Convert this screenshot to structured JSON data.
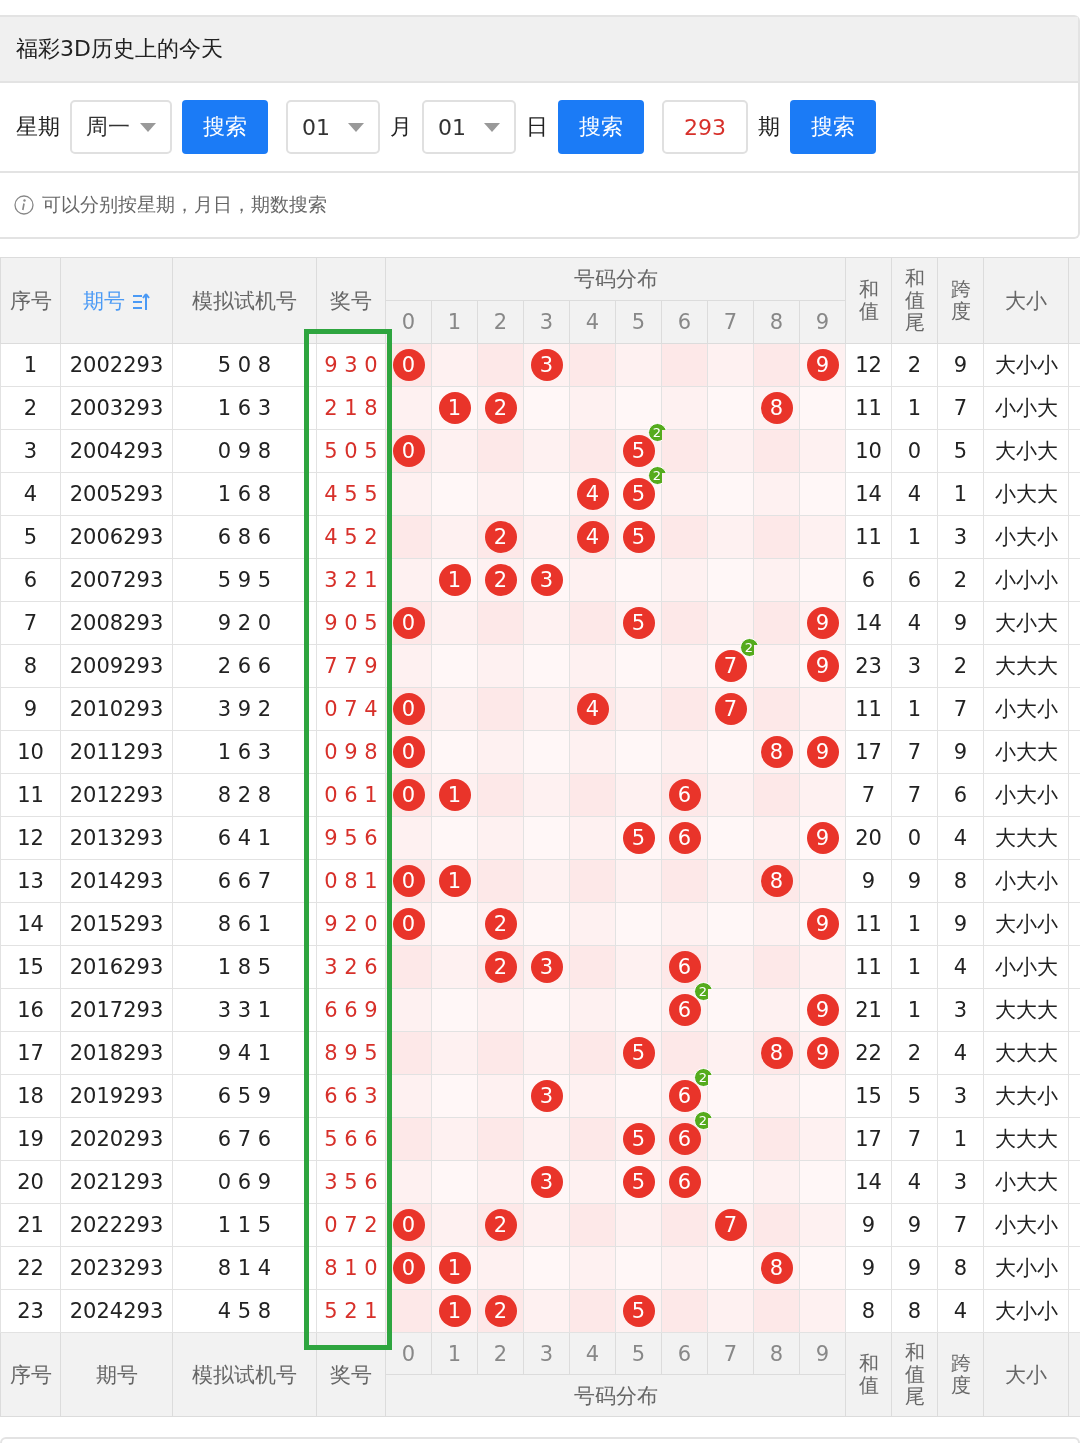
{
  "page_title": "福彩3D历史上的今天",
  "search": {
    "weekday_label": "星期",
    "weekday": "周一",
    "weekday_button": "搜索",
    "month": "01",
    "month_label": "月",
    "day": "01",
    "day_label": "日",
    "date_button": "搜索",
    "issue": "293",
    "issue_label": "期",
    "issue_button": "搜索"
  },
  "hint": "可以分别按星期，月日，期数搜索",
  "table": {
    "header_columns": [
      {
        "label": "序号",
        "sorted": false
      },
      {
        "label": "期号",
        "sorted": true
      },
      {
        "label": "模拟试机号",
        "sorted": false
      },
      {
        "label": "奖号",
        "sorted": false
      }
    ],
    "distribution_title": "号码分布",
    "digits": [
      "0",
      "1",
      "2",
      "3",
      "4",
      "5",
      "6",
      "7",
      "8",
      "9"
    ],
    "stat_columns": [
      "和值",
      "和值尾",
      "跨度",
      "大小"
    ],
    "rows": [
      {
        "seq": "1",
        "issue": "2002293",
        "test": "5 0 8",
        "prize": "9 3 0",
        "dist": {
          "0": {
            "ball": "0"
          },
          "3": {
            "ball": "3"
          },
          "9": {
            "ball": "9"
          }
        },
        "sum": "12",
        "sum_tail": "2",
        "span": "9",
        "size": "大小小"
      },
      {
        "seq": "2",
        "issue": "2003293",
        "test": "1 6 3",
        "prize": "2 1 8",
        "dist": {
          "1": {
            "ball": "1"
          },
          "2": {
            "ball": "2"
          },
          "8": {
            "ball": "8"
          }
        },
        "sum": "11",
        "sum_tail": "1",
        "span": "7",
        "size": "小小大"
      },
      {
        "seq": "3",
        "issue": "2004293",
        "test": "0 9 8",
        "prize": "5 0 5",
        "dist": {
          "0": {
            "ball": "0"
          },
          "5": {
            "ball": "5",
            "repeat": "2"
          }
        },
        "sum": "10",
        "sum_tail": "0",
        "span": "5",
        "size": "大小大"
      },
      {
        "seq": "4",
        "issue": "2005293",
        "test": "1 6 8",
        "prize": "4 5 5",
        "dist": {
          "4": {
            "ball": "4"
          },
          "5": {
            "ball": "5",
            "repeat": "2"
          }
        },
        "sum": "14",
        "sum_tail": "4",
        "span": "1",
        "size": "小大大"
      },
      {
        "seq": "5",
        "issue": "2006293",
        "test": "6 8 6",
        "prize": "4 5 2",
        "dist": {
          "2": {
            "ball": "2"
          },
          "4": {
            "ball": "4"
          },
          "5": {
            "ball": "5"
          }
        },
        "sum": "11",
        "sum_tail": "1",
        "span": "3",
        "size": "小大小"
      },
      {
        "seq": "6",
        "issue": "2007293",
        "test": "5 9 5",
        "prize": "3 2 1",
        "dist": {
          "1": {
            "ball": "1"
          },
          "2": {
            "ball": "2"
          },
          "3": {
            "ball": "3"
          }
        },
        "sum": "6",
        "sum_tail": "6",
        "span": "2",
        "size": "小小小"
      },
      {
        "seq": "7",
        "issue": "2008293",
        "test": "9 2 0",
        "prize": "9 0 5",
        "dist": {
          "0": {
            "ball": "0"
          },
          "5": {
            "ball": "5"
          },
          "9": {
            "ball": "9"
          }
        },
        "sum": "14",
        "sum_tail": "4",
        "span": "9",
        "size": "大小大"
      },
      {
        "seq": "8",
        "issue": "2009293",
        "test": "2 6 6",
        "prize": "7 7 9",
        "dist": {
          "7": {
            "ball": "7",
            "repeat": "2"
          },
          "9": {
            "ball": "9"
          }
        },
        "sum": "23",
        "sum_tail": "3",
        "span": "2",
        "size": "大大大"
      },
      {
        "seq": "9",
        "issue": "2010293",
        "test": "3 9 2",
        "prize": "0 7 4",
        "dist": {
          "0": {
            "ball": "0"
          },
          "4": {
            "ball": "4"
          },
          "7": {
            "ball": "7"
          }
        },
        "sum": "11",
        "sum_tail": "1",
        "span": "7",
        "size": "小大小"
      },
      {
        "seq": "10",
        "issue": "2011293",
        "test": "1 6 3",
        "prize": "0 9 8",
        "dist": {
          "0": {
            "ball": "0"
          },
          "8": {
            "ball": "8"
          },
          "9": {
            "ball": "9"
          }
        },
        "sum": "17",
        "sum_tail": "7",
        "span": "9",
        "size": "小大大"
      },
      {
        "seq": "11",
        "issue": "2012293",
        "test": "8 2 8",
        "prize": "0 6 1",
        "dist": {
          "0": {
            "ball": "0"
          },
          "1": {
            "ball": "1"
          },
          "6": {
            "ball": "6"
          }
        },
        "sum": "7",
        "sum_tail": "7",
        "span": "6",
        "size": "小大小"
      },
      {
        "seq": "12",
        "issue": "2013293",
        "test": "6 4 1",
        "prize": "9 5 6",
        "dist": {
          "5": {
            "ball": "5"
          },
          "6": {
            "ball": "6"
          },
          "9": {
            "ball": "9"
          }
        },
        "sum": "20",
        "sum_tail": "0",
        "span": "4",
        "size": "大大大"
      },
      {
        "seq": "13",
        "issue": "2014293",
        "test": "6 6 7",
        "prize": "0 8 1",
        "dist": {
          "0": {
            "ball": "0"
          },
          "1": {
            "ball": "1"
          },
          "8": {
            "ball": "8"
          }
        },
        "sum": "9",
        "sum_tail": "9",
        "span": "8",
        "size": "小大小"
      },
      {
        "seq": "14",
        "issue": "2015293",
        "test": "8 6 1",
        "prize": "9 2 0",
        "dist": {
          "0": {
            "ball": "0"
          },
          "2": {
            "ball": "2"
          },
          "9": {
            "ball": "9"
          }
        },
        "sum": "11",
        "sum_tail": "1",
        "span": "9",
        "size": "大小小"
      },
      {
        "seq": "15",
        "issue": "2016293",
        "test": "1 8 5",
        "prize": "3 2 6",
        "dist": {
          "2": {
            "ball": "2"
          },
          "3": {
            "ball": "3"
          },
          "6": {
            "ball": "6"
          }
        },
        "sum": "11",
        "sum_tail": "1",
        "span": "4",
        "size": "小小大"
      },
      {
        "seq": "16",
        "issue": "2017293",
        "test": "3 3 1",
        "prize": "6 6 9",
        "dist": {
          "6": {
            "ball": "6",
            "repeat": "2"
          },
          "9": {
            "ball": "9"
          }
        },
        "sum": "21",
        "sum_tail": "1",
        "span": "3",
        "size": "大大大"
      },
      {
        "seq": "17",
        "issue": "2018293",
        "test": "9 4 1",
        "prize": "8 9 5",
        "dist": {
          "5": {
            "ball": "5"
          },
          "8": {
            "ball": "8"
          },
          "9": {
            "ball": "9"
          }
        },
        "sum": "22",
        "sum_tail": "2",
        "span": "4",
        "size": "大大大"
      },
      {
        "seq": "18",
        "issue": "2019293",
        "test": "6 5 9",
        "prize": "6 6 3",
        "dist": {
          "3": {
            "ball": "3"
          },
          "6": {
            "ball": "6",
            "repeat": "2"
          }
        },
        "sum": "15",
        "sum_tail": "5",
        "span": "3",
        "size": "大大小"
      },
      {
        "seq": "19",
        "issue": "2020293",
        "test": "6 7 6",
        "prize": "5 6 6",
        "dist": {
          "5": {
            "ball": "5"
          },
          "6": {
            "ball": "6",
            "repeat": "2"
          }
        },
        "sum": "17",
        "sum_tail": "7",
        "span": "1",
        "size": "大大大"
      },
      {
        "seq": "20",
        "issue": "2021293",
        "test": "0 6 9",
        "prize": "3 5 6",
        "dist": {
          "3": {
            "ball": "3"
          },
          "5": {
            "ball": "5"
          },
          "6": {
            "ball": "6"
          }
        },
        "sum": "14",
        "sum_tail": "4",
        "span": "3",
        "size": "小大大"
      },
      {
        "seq": "21",
        "issue": "2022293",
        "test": "1 1 5",
        "prize": "0 7 2",
        "dist": {
          "0": {
            "ball": "0"
          },
          "2": {
            "ball": "2"
          },
          "7": {
            "ball": "7"
          }
        },
        "sum": "9",
        "sum_tail": "9",
        "span": "7",
        "size": "小大小"
      },
      {
        "seq": "22",
        "issue": "2023293",
        "test": "8 1 4",
        "prize": "8 1 0",
        "dist": {
          "0": {
            "ball": "0"
          },
          "1": {
            "ball": "1"
          },
          "8": {
            "ball": "8"
          }
        },
        "sum": "9",
        "sum_tail": "9",
        "span": "8",
        "size": "大小小"
      },
      {
        "seq": "23",
        "issue": "2024293",
        "test": "4 5 8",
        "prize": "5 2 1",
        "dist": {
          "1": {
            "ball": "1"
          },
          "2": {
            "ball": "2"
          },
          "5": {
            "ball": "5"
          }
        },
        "sum": "8",
        "sum_tail": "8",
        "span": "4",
        "size": "大小小"
      }
    ],
    "footer_columns": [
      "序号",
      "期号",
      "模拟试机号",
      "奖号"
    ],
    "footer_digits": [
      "0",
      "1",
      "2",
      "3",
      "4",
      "5",
      "6",
      "7",
      "8",
      "9"
    ],
    "footer_distribution_title": "号码分布",
    "footer_stat_columns": [
      "和值",
      "和值尾",
      "跨度",
      "大小"
    ]
  }
}
